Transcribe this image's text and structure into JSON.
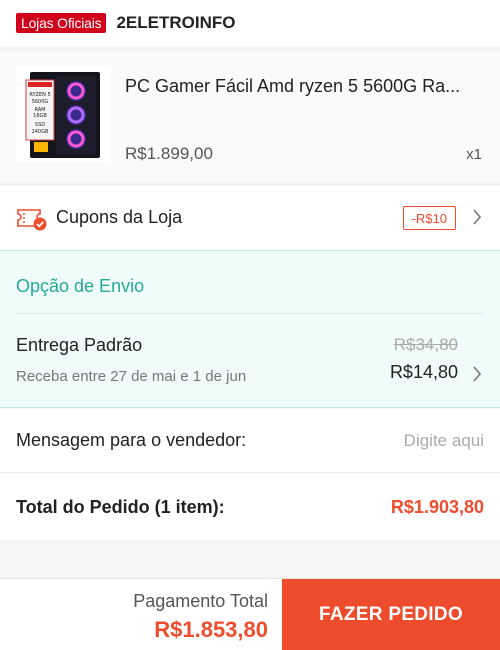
{
  "shop": {
    "badge": "Lojas Oficiais",
    "name": "2ELETROINFO"
  },
  "product": {
    "title": "PC Gamer Fácil Amd ryzen 5 5600G Ra...",
    "price": "R$1.899,00",
    "quantity": "x1",
    "image_icon": "gaming-pc-case-image",
    "image_box_text": [
      "RYZEN 5",
      "5600G",
      "RAM",
      "16GB",
      "SSD",
      "240GB"
    ]
  },
  "coupon": {
    "label": "Cupons da Loja",
    "tag": "-R$10"
  },
  "shipping": {
    "title": "Opção de Envio",
    "method": "Entrega Padrão",
    "eta": "Receba entre 27 de mai e 1 de jun",
    "old_price": "R$34,80",
    "new_price": "R$14,80"
  },
  "message": {
    "label": "Mensagem para o vendedor:",
    "placeholder": "Digite aqui"
  },
  "order_total": {
    "label": "Total do Pedido (1 item):",
    "value": "R$1.903,80"
  },
  "footer": {
    "payment_label": "Pagamento Total",
    "payment_value": "R$1.853,80",
    "order_button": "FAZER PEDIDO"
  },
  "colors": {
    "brand_orange": "#ee4d2d",
    "official_red": "#d0011b",
    "shipping_teal": "#26aa99",
    "shipping_bg": "#f0fcfa"
  }
}
